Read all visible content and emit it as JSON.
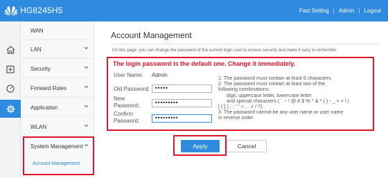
{
  "header": {
    "product_name": "HG8245H5",
    "nav": [
      "Fast Setting",
      "Admin",
      "Logout"
    ],
    "brand_color": "#2e8be0"
  },
  "icon_column": [
    {
      "icon": "home-icon"
    },
    {
      "icon": "add-box-icon"
    },
    {
      "icon": "gauge-icon"
    },
    {
      "icon": "gear-icon",
      "active": true
    }
  ],
  "menu": {
    "items": [
      {
        "label": "WAN",
        "expandable": false
      },
      {
        "label": "LAN",
        "expandable": true
      },
      {
        "label": "Security",
        "expandable": true
      },
      {
        "label": "Forward Rules",
        "expandable": true
      },
      {
        "label": "Application",
        "expandable": true
      },
      {
        "label": "WLAN",
        "expandable": true
      },
      {
        "label": "System Management",
        "expandable": true,
        "expanded": true
      }
    ],
    "sub_item": "Account Management"
  },
  "main": {
    "title": "Account Management",
    "description": "On this page, you can change the password of the current login user to ensure security and make it easy to remember.",
    "warning": "The login password is the default one. Change it immediately.",
    "user_name_label": "User Name:",
    "user_name_value": "Admin",
    "old_password_label": "Old Password:",
    "old_password_value": "•••••",
    "new_password_label_1": "New",
    "new_password_label_2": "Password:",
    "new_password_value": "•••••••••",
    "confirm_password_label_1": "Confirm",
    "confirm_password_label_2": "Password:",
    "confirm_password_value": "•••••••••",
    "rules": [
      "1. The password must contain at least 6 characters.",
      "2. The password must contain at least two of the",
      "following combinations:",
      "  digit, uppercase letter, lowercase letter",
      "  and special characters ( ` ~ ! @ # $ % ^ & * ( ) - _ = + \\ |",
      "[ { } ] ; : ' \" < , . > / ?).",
      "3. The password cannot be any user name or user name",
      "in reverse order."
    ],
    "apply_label": "Apply",
    "cancel_label": "Cancel"
  },
  "annotation_color": "#e0142c"
}
